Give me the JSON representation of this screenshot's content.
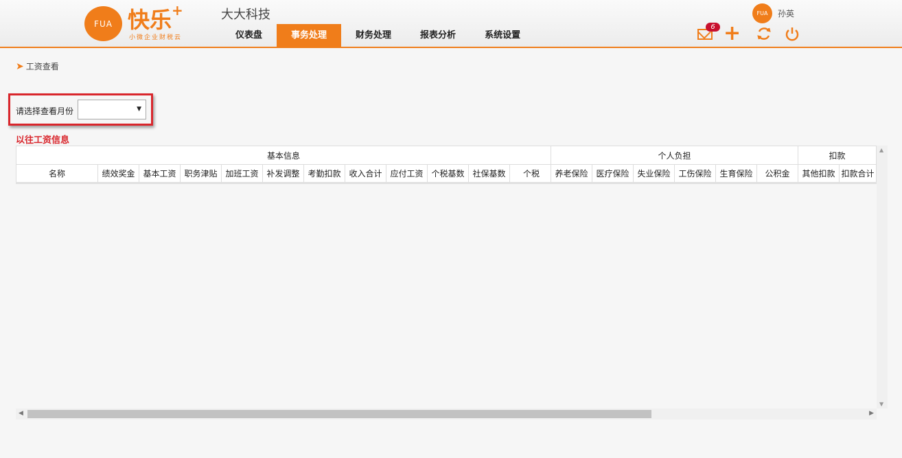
{
  "header": {
    "logo_text": "FUA",
    "brand_name": "快乐",
    "brand_plus": "+",
    "brand_tagline": "小微企业财税云",
    "company": "大大科技",
    "nav": [
      "仪表盘",
      "事务处理",
      "财务处理",
      "报表分析",
      "系统设置"
    ],
    "active_nav": "事务处理",
    "avatar_text": "FUA",
    "username": "孙英",
    "mail_count": "6",
    "accent_color": "#f07d1a"
  },
  "breadcrumb": {
    "label": "工资查看"
  },
  "filter": {
    "label": "请选择查看月份",
    "selected": ""
  },
  "section_title": "以往工资信息",
  "table": {
    "groups": [
      {
        "label": "基本信息"
      },
      {
        "label": "个人负担"
      },
      {
        "label": "扣款"
      }
    ],
    "columns": [
      "名称",
      "绩效奖金",
      "基本工资",
      "职务津贴",
      "加班工资",
      "补发调整",
      "考勤扣款",
      "收入合计",
      "应付工资",
      "个税基数",
      "社保基数",
      "个税",
      "养老保险",
      "医疗保险",
      "失业保险",
      "工伤保险",
      "生育保险",
      "公积金",
      "其他扣款",
      "扣款合计"
    ],
    "rows": []
  }
}
